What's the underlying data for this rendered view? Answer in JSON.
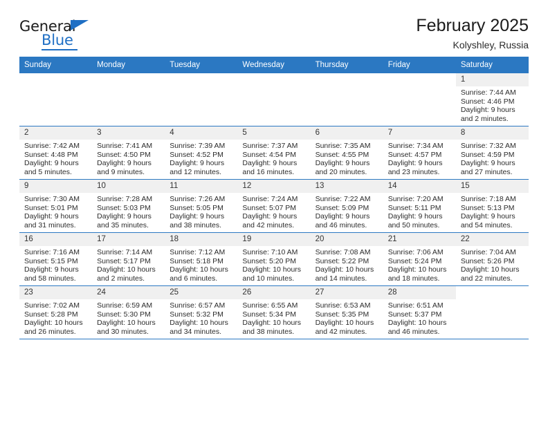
{
  "brand": {
    "name_top": "General",
    "name_bottom": "Blue",
    "accent_color": "#1f6fc4"
  },
  "header": {
    "title": "February 2025",
    "subtitle": "Kolyshley, Russia"
  },
  "theme": {
    "header_row_bg": "#2b78c2",
    "daynum_bg": "#f0f0f0",
    "grid_line": "#2b78c2",
    "text": "#2b2b2b"
  },
  "calendar": {
    "weekday_headers": [
      "Sunday",
      "Monday",
      "Tuesday",
      "Wednesday",
      "Thursday",
      "Friday",
      "Saturday"
    ],
    "weeks": [
      [
        {
          "day": "",
          "empty": true
        },
        {
          "day": "",
          "empty": true
        },
        {
          "day": "",
          "empty": true
        },
        {
          "day": "",
          "empty": true
        },
        {
          "day": "",
          "empty": true
        },
        {
          "day": "",
          "empty": true
        },
        {
          "day": "1",
          "sunrise": "Sunrise: 7:44 AM",
          "sunset": "Sunset: 4:46 PM",
          "daylight_1": "Daylight: 9 hours",
          "daylight_2": "and 2 minutes."
        }
      ],
      [
        {
          "day": "2",
          "sunrise": "Sunrise: 7:42 AM",
          "sunset": "Sunset: 4:48 PM",
          "daylight_1": "Daylight: 9 hours",
          "daylight_2": "and 5 minutes."
        },
        {
          "day": "3",
          "sunrise": "Sunrise: 7:41 AM",
          "sunset": "Sunset: 4:50 PM",
          "daylight_1": "Daylight: 9 hours",
          "daylight_2": "and 9 minutes."
        },
        {
          "day": "4",
          "sunrise": "Sunrise: 7:39 AM",
          "sunset": "Sunset: 4:52 PM",
          "daylight_1": "Daylight: 9 hours",
          "daylight_2": "and 12 minutes."
        },
        {
          "day": "5",
          "sunrise": "Sunrise: 7:37 AM",
          "sunset": "Sunset: 4:54 PM",
          "daylight_1": "Daylight: 9 hours",
          "daylight_2": "and 16 minutes."
        },
        {
          "day": "6",
          "sunrise": "Sunrise: 7:35 AM",
          "sunset": "Sunset: 4:55 PM",
          "daylight_1": "Daylight: 9 hours",
          "daylight_2": "and 20 minutes."
        },
        {
          "day": "7",
          "sunrise": "Sunrise: 7:34 AM",
          "sunset": "Sunset: 4:57 PM",
          "daylight_1": "Daylight: 9 hours",
          "daylight_2": "and 23 minutes."
        },
        {
          "day": "8",
          "sunrise": "Sunrise: 7:32 AM",
          "sunset": "Sunset: 4:59 PM",
          "daylight_1": "Daylight: 9 hours",
          "daylight_2": "and 27 minutes."
        }
      ],
      [
        {
          "day": "9",
          "sunrise": "Sunrise: 7:30 AM",
          "sunset": "Sunset: 5:01 PM",
          "daylight_1": "Daylight: 9 hours",
          "daylight_2": "and 31 minutes."
        },
        {
          "day": "10",
          "sunrise": "Sunrise: 7:28 AM",
          "sunset": "Sunset: 5:03 PM",
          "daylight_1": "Daylight: 9 hours",
          "daylight_2": "and 35 minutes."
        },
        {
          "day": "11",
          "sunrise": "Sunrise: 7:26 AM",
          "sunset": "Sunset: 5:05 PM",
          "daylight_1": "Daylight: 9 hours",
          "daylight_2": "and 38 minutes."
        },
        {
          "day": "12",
          "sunrise": "Sunrise: 7:24 AM",
          "sunset": "Sunset: 5:07 PM",
          "daylight_1": "Daylight: 9 hours",
          "daylight_2": "and 42 minutes."
        },
        {
          "day": "13",
          "sunrise": "Sunrise: 7:22 AM",
          "sunset": "Sunset: 5:09 PM",
          "daylight_1": "Daylight: 9 hours",
          "daylight_2": "and 46 minutes."
        },
        {
          "day": "14",
          "sunrise": "Sunrise: 7:20 AM",
          "sunset": "Sunset: 5:11 PM",
          "daylight_1": "Daylight: 9 hours",
          "daylight_2": "and 50 minutes."
        },
        {
          "day": "15",
          "sunrise": "Sunrise: 7:18 AM",
          "sunset": "Sunset: 5:13 PM",
          "daylight_1": "Daylight: 9 hours",
          "daylight_2": "and 54 minutes."
        }
      ],
      [
        {
          "day": "16",
          "sunrise": "Sunrise: 7:16 AM",
          "sunset": "Sunset: 5:15 PM",
          "daylight_1": "Daylight: 9 hours",
          "daylight_2": "and 58 minutes."
        },
        {
          "day": "17",
          "sunrise": "Sunrise: 7:14 AM",
          "sunset": "Sunset: 5:17 PM",
          "daylight_1": "Daylight: 10 hours",
          "daylight_2": "and 2 minutes."
        },
        {
          "day": "18",
          "sunrise": "Sunrise: 7:12 AM",
          "sunset": "Sunset: 5:18 PM",
          "daylight_1": "Daylight: 10 hours",
          "daylight_2": "and 6 minutes."
        },
        {
          "day": "19",
          "sunrise": "Sunrise: 7:10 AM",
          "sunset": "Sunset: 5:20 PM",
          "daylight_1": "Daylight: 10 hours",
          "daylight_2": "and 10 minutes."
        },
        {
          "day": "20",
          "sunrise": "Sunrise: 7:08 AM",
          "sunset": "Sunset: 5:22 PM",
          "daylight_1": "Daylight: 10 hours",
          "daylight_2": "and 14 minutes."
        },
        {
          "day": "21",
          "sunrise": "Sunrise: 7:06 AM",
          "sunset": "Sunset: 5:24 PM",
          "daylight_1": "Daylight: 10 hours",
          "daylight_2": "and 18 minutes."
        },
        {
          "day": "22",
          "sunrise": "Sunrise: 7:04 AM",
          "sunset": "Sunset: 5:26 PM",
          "daylight_1": "Daylight: 10 hours",
          "daylight_2": "and 22 minutes."
        }
      ],
      [
        {
          "day": "23",
          "sunrise": "Sunrise: 7:02 AM",
          "sunset": "Sunset: 5:28 PM",
          "daylight_1": "Daylight: 10 hours",
          "daylight_2": "and 26 minutes."
        },
        {
          "day": "24",
          "sunrise": "Sunrise: 6:59 AM",
          "sunset": "Sunset: 5:30 PM",
          "daylight_1": "Daylight: 10 hours",
          "daylight_2": "and 30 minutes."
        },
        {
          "day": "25",
          "sunrise": "Sunrise: 6:57 AM",
          "sunset": "Sunset: 5:32 PM",
          "daylight_1": "Daylight: 10 hours",
          "daylight_2": "and 34 minutes."
        },
        {
          "day": "26",
          "sunrise": "Sunrise: 6:55 AM",
          "sunset": "Sunset: 5:34 PM",
          "daylight_1": "Daylight: 10 hours",
          "daylight_2": "and 38 minutes."
        },
        {
          "day": "27",
          "sunrise": "Sunrise: 6:53 AM",
          "sunset": "Sunset: 5:35 PM",
          "daylight_1": "Daylight: 10 hours",
          "daylight_2": "and 42 minutes."
        },
        {
          "day": "28",
          "sunrise": "Sunrise: 6:51 AM",
          "sunset": "Sunset: 5:37 PM",
          "daylight_1": "Daylight: 10 hours",
          "daylight_2": "and 46 minutes."
        },
        {
          "day": "",
          "empty": true
        }
      ]
    ]
  }
}
